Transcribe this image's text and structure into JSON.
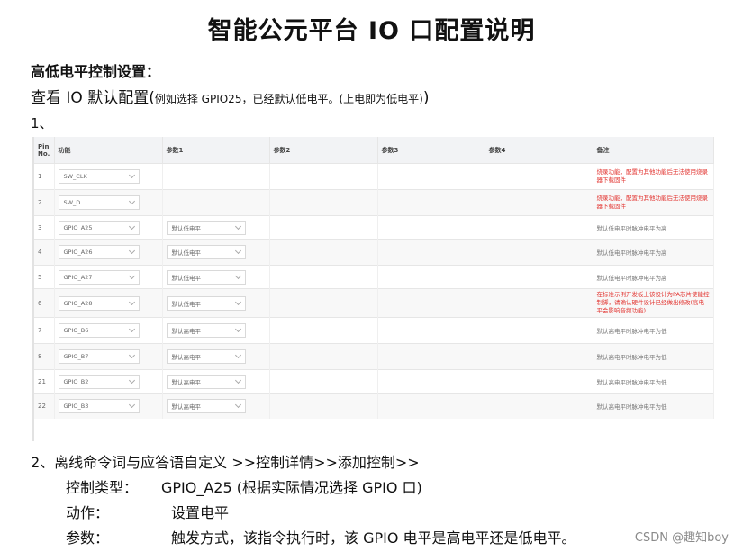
{
  "doc": {
    "title": "智能公元平台 IO 口配置说明",
    "section_heading": "高低电平控制设置：",
    "intro_main": "查看 IO 默认配置(",
    "intro_small": "例如选择 GPIO25，已经默认低电平。(上电即为低电平)",
    "intro_end": ")",
    "step1": "1、",
    "step2": "2、离线命令词与应答语自定义 >>控制详情>>添加控制>>",
    "details": [
      {
        "label": "控制类型：",
        "value": "GPIO_A25 (根据实际情况选择 GPIO 口)"
      },
      {
        "label": "动作：",
        "value": "设置电平"
      },
      {
        "label": "参数：",
        "value": "触发方式，该指令执行时，该 GPIO 电平是高电平还是低电平。"
      }
    ],
    "watermark": "CSDN @趣知boy"
  },
  "table": {
    "headers": [
      "Pin No.",
      "功能",
      "参数1",
      "参数2",
      "参数3",
      "参数4",
      "备注"
    ],
    "rows": [
      {
        "pin": "1",
        "func": "SW_CLK",
        "p1": "",
        "note": "烧录功能，配置为其他功能后无法使用烧录器下载固件",
        "note_color": "red"
      },
      {
        "pin": "2",
        "func": "SW_D",
        "p1": "",
        "note": "烧录功能，配置为其他功能后无法使用烧录器下载固件",
        "note_color": "red"
      },
      {
        "pin": "3",
        "func": "GPIO_A25",
        "p1": "默认低电平",
        "note": "默认低电平时脉冲电平为高",
        "note_color": "gray"
      },
      {
        "pin": "4",
        "func": "GPIO_A26",
        "p1": "默认低电平",
        "note": "默认低电平时脉冲电平为高",
        "note_color": "gray"
      },
      {
        "pin": "5",
        "func": "GPIO_A27",
        "p1": "默认低电平",
        "note": "默认低电平时脉冲电平为高",
        "note_color": "gray"
      },
      {
        "pin": "6",
        "func": "GPIO_A28",
        "p1": "默认低电平",
        "note": "在标准示例开发板上该设计为PA芯片使能控制脚，请确认硬件设计已经做出修改(高电平会影响音频功能)",
        "note_color": "red"
      },
      {
        "pin": "7",
        "func": "GPIO_B6",
        "p1": "默认高电平",
        "note": "默认高电平时脉冲电平为低",
        "note_color": "gray"
      },
      {
        "pin": "8",
        "func": "GPIO_B7",
        "p1": "默认高电平",
        "note": "默认高电平时脉冲电平为低",
        "note_color": "gray"
      },
      {
        "pin": "21",
        "func": "GPIO_B2",
        "p1": "默认高电平",
        "note": "默认高电平时脉冲电平为低",
        "note_color": "gray"
      },
      {
        "pin": "22",
        "func": "GPIO_B3",
        "p1": "默认高电平",
        "note": "默认高电平时脉冲电平为低",
        "note_color": "gray"
      }
    ]
  },
  "colors": {
    "note_red": "#e2332f",
    "header_bg": "#f2f3f5"
  }
}
